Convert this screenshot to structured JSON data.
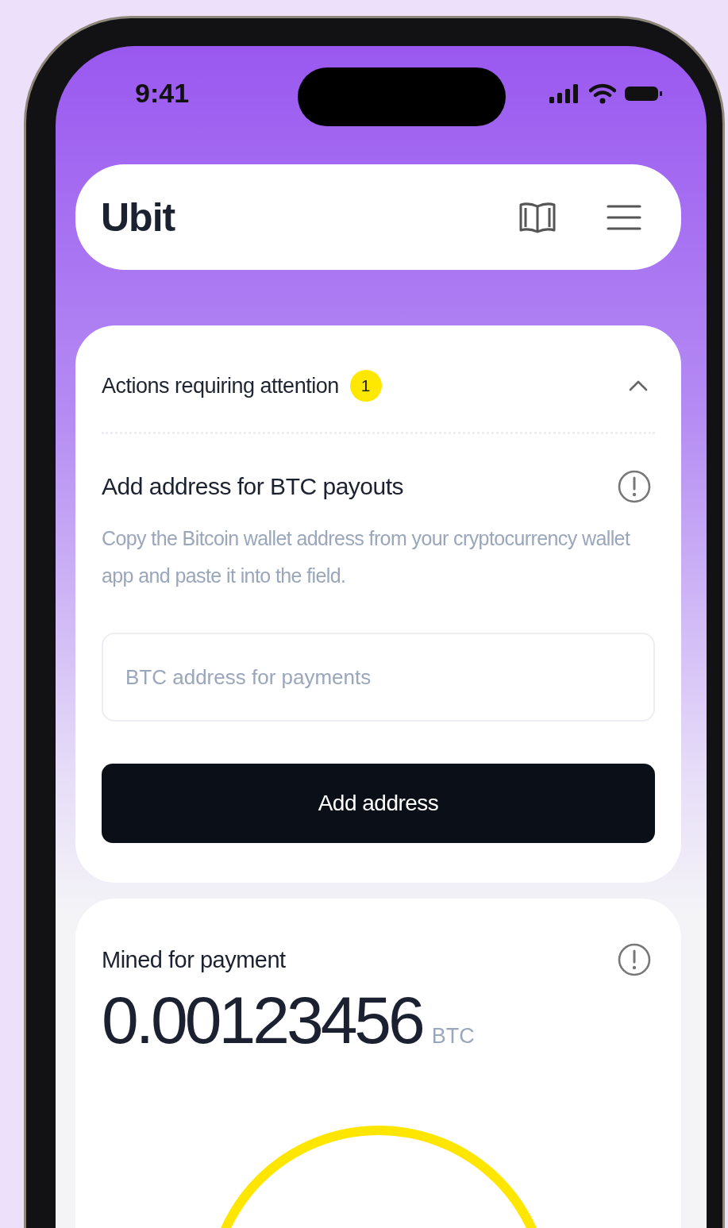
{
  "status_bar": {
    "time": "9:41"
  },
  "header": {
    "logo": "Ubit"
  },
  "attention_card": {
    "title": "Actions requiring attention",
    "count": "1",
    "expanded": true,
    "task": {
      "title": "Add address for BTC payouts",
      "description": "Copy the Bitcoin wallet address from your cryptocurrency wallet app and paste it into the field.",
      "input": {
        "placeholder": "BTC address for payments"
      },
      "button": "Add address"
    }
  },
  "mined_card": {
    "label": "Mined for payment",
    "amount": "0.00123456",
    "unit": "BTC"
  }
}
